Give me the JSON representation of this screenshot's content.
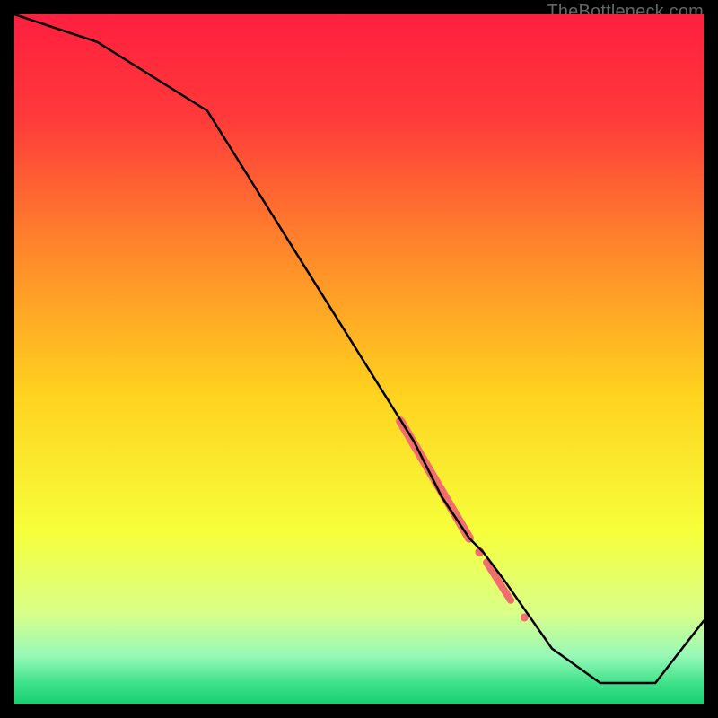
{
  "watermark": "TheBottleneck.com",
  "chart_data": {
    "type": "line",
    "title": "",
    "xlabel": "",
    "ylabel": "",
    "xlim": [
      0,
      100
    ],
    "ylim": [
      0,
      100
    ],
    "grid": false,
    "legend": false,
    "gradient_stops": [
      {
        "offset": 0.0,
        "color": "#ff1f3f"
      },
      {
        "offset": 0.15,
        "color": "#ff3a3a"
      },
      {
        "offset": 0.35,
        "color": "#ff8a2a"
      },
      {
        "offset": 0.55,
        "color": "#ffd21f"
      },
      {
        "offset": 0.75,
        "color": "#f6ff3a"
      },
      {
        "offset": 0.87,
        "color": "#d8ff8a"
      },
      {
        "offset": 0.93,
        "color": "#98f9b8"
      },
      {
        "offset": 0.97,
        "color": "#3fe28a"
      },
      {
        "offset": 1.0,
        "color": "#18d072"
      }
    ],
    "series": [
      {
        "name": "bottleneck-curve",
        "color": "#000000",
        "width": 2.5,
        "x": [
          0,
          12,
          28,
          58,
          62,
          66,
          68,
          71,
          78,
          85,
          93,
          100
        ],
        "y": [
          100,
          96,
          86,
          38,
          30,
          24,
          22,
          18,
          8,
          3,
          3,
          12
        ]
      }
    ],
    "markers": [
      {
        "name": "highlight-thick",
        "shape": "line",
        "color": "#f26d6d",
        "width": 10,
        "points": [
          {
            "x": 56,
            "y": 41
          },
          {
            "x": 66,
            "y": 24
          }
        ]
      },
      {
        "name": "highlight-dot-1",
        "shape": "dot",
        "color": "#f26d6d",
        "r": 5,
        "cx": 67.5,
        "cy": 22
      },
      {
        "name": "highlight-seg-2",
        "shape": "line",
        "color": "#f26d6d",
        "width": 8,
        "points": [
          {
            "x": 68.5,
            "y": 20.5
          },
          {
            "x": 72,
            "y": 15
          }
        ]
      },
      {
        "name": "highlight-dot-2",
        "shape": "dot",
        "color": "#f26d6d",
        "r": 4.5,
        "cx": 74,
        "cy": 12.5
      }
    ]
  }
}
